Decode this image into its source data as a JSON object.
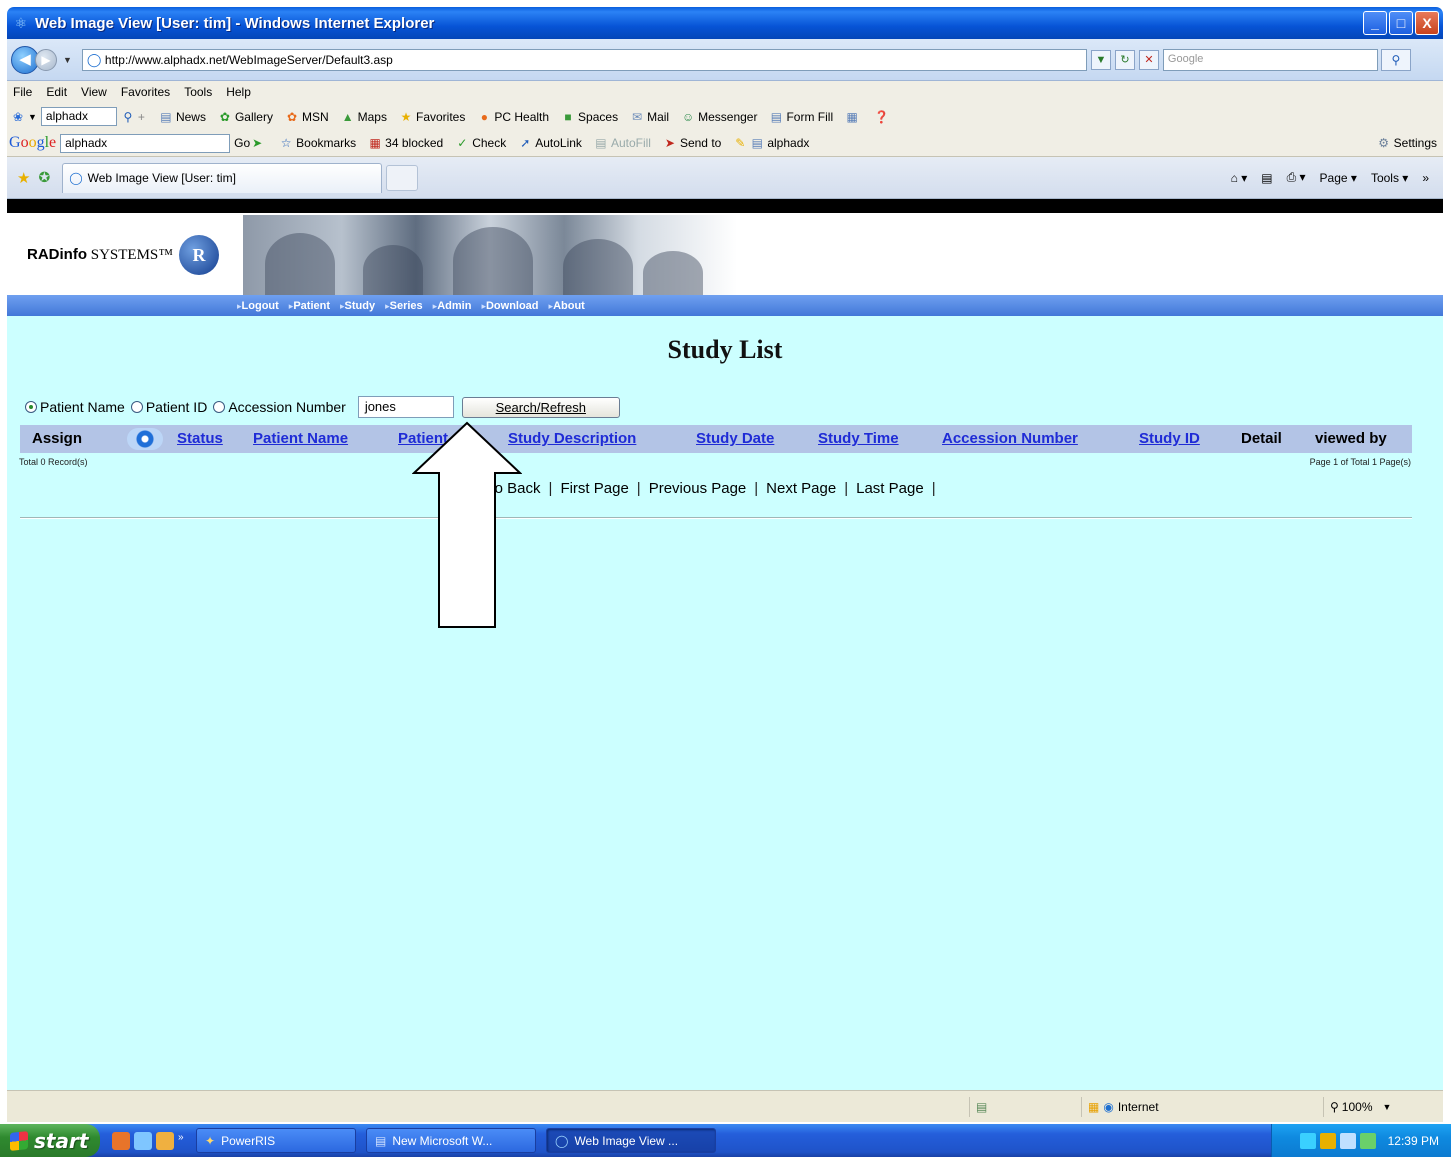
{
  "window": {
    "title": "Web Image View [User: tim] - Windows Internet Explorer",
    "buttons": [
      "_",
      "□",
      "X"
    ]
  },
  "address_bar": {
    "url": "http://www.alphadx.net/WebImageServer/Default3.asp",
    "search_placeholder": "Google"
  },
  "menu": [
    "File",
    "Edit",
    "View",
    "Favorites",
    "Tools",
    "Help"
  ],
  "toolbar1": {
    "search_value": "alphadx",
    "items": [
      "News",
      "Gallery",
      "MSN",
      "Maps",
      "Favorites",
      "PC Health",
      "Spaces",
      "Mail",
      "Messenger",
      "Form Fill"
    ]
  },
  "toolbar2": {
    "search_value": "alphadx",
    "go": "Go",
    "items": [
      "Bookmarks",
      "34 blocked",
      "Check",
      "AutoLink",
      "AutoFill",
      "Send to",
      "alphadx"
    ],
    "settings": "Settings"
  },
  "tabs": {
    "active": "Web Image View [User: tim]",
    "tools": [
      "Page",
      "Tools"
    ]
  },
  "site": {
    "logo_bold": "RADinfo",
    "logo_rest": "SYSTEMS",
    "logo_mark": "R",
    "nav": [
      "Logout",
      "Patient",
      "Study",
      "Series",
      "Admin",
      "Download",
      "About"
    ]
  },
  "page": {
    "title": "Study List",
    "radios": [
      {
        "label": "Patient Name",
        "checked": true
      },
      {
        "label": "Patient ID",
        "checked": false
      },
      {
        "label": "Accession Number",
        "checked": false
      }
    ],
    "search_value": "jones",
    "search_button": "Search/Refresh",
    "columns": [
      {
        "label": "Assign",
        "link": false
      },
      {
        "label": "Status",
        "link": true
      },
      {
        "label": "Patient Name",
        "link": true
      },
      {
        "label": "Patient",
        "link": true
      },
      {
        "label": "Study Description",
        "link": true
      },
      {
        "label": "Study Date",
        "link": true
      },
      {
        "label": "Study Time",
        "link": true
      },
      {
        "label": "Accession Number",
        "link": true
      },
      {
        "label": "Study ID",
        "link": true
      },
      {
        "label": "Detail",
        "link": false
      },
      {
        "label": "viewed by",
        "link": false
      }
    ],
    "records_text": "Total 0 Record(s)",
    "page_info": "Page 1 of Total 1 Page(s)",
    "pager": [
      "Go Back",
      "First Page",
      "Previous Page",
      "Next Page",
      "Last Page"
    ]
  },
  "statusbar": {
    "zone": "Internet",
    "zoom": "100%"
  },
  "taskbar": {
    "start": "start",
    "buttons": [
      "PowerRIS",
      "New Microsoft W...",
      "Web Image View ..."
    ],
    "time": "12:39 PM"
  }
}
